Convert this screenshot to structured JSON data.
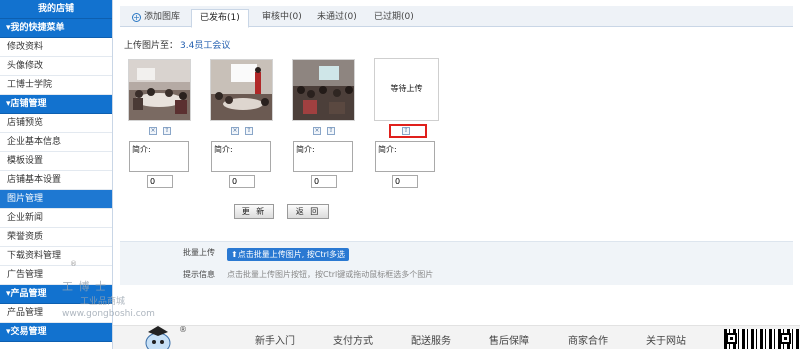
{
  "sidebar": {
    "store_header": "我的店铺",
    "quick_menu": {
      "title": "▾我的快捷菜单",
      "items": [
        "修改资料",
        "头像修改",
        "工博士学院"
      ]
    },
    "store_manage": {
      "title": "▾店铺管理",
      "items": [
        "店铺预览",
        "企业基本信息",
        "模板设置",
        "店铺基本设置",
        "图片管理",
        "企业新闻",
        "荣誉资质",
        "下载资料管理",
        "广告管理"
      ]
    },
    "product_manage": {
      "title": "▾产品管理",
      "items": [
        "产品管理"
      ]
    },
    "trade_manage": {
      "title": "▾交易管理"
    },
    "active_item": "图片管理"
  },
  "tabs": [
    {
      "label": "添加图库",
      "icon": "plus-icon"
    },
    {
      "label": "已发布(1)",
      "active": true
    },
    {
      "label": "审核中(0)"
    },
    {
      "label": "未通过(0)"
    },
    {
      "label": "已过期(0)"
    }
  ],
  "upload_to": {
    "label": "上传图片至：",
    "album": "3.4员工会议"
  },
  "photos": [
    {
      "memo_label": "简介:",
      "memo_value": "",
      "order": "0"
    },
    {
      "memo_label": "简介:",
      "memo_value": "",
      "order": "0"
    },
    {
      "memo_label": "简介:",
      "memo_value": "",
      "order": "0"
    },
    {
      "memo_label": "简介:",
      "memo_value": "",
      "order": "0",
      "pending_text": "等待上传"
    }
  ],
  "buttons": {
    "update": "更 新",
    "back": "返 回"
  },
  "batch": {
    "label": "批量上传",
    "button": "⬆点击批量上传图片, 按Ctrl多选",
    "tip_label": "提示信息",
    "tip_text": "点击批量上传图片按钮，按Ctrl键或拖动鼠标框选多个图片"
  },
  "footer": {
    "links": [
      "新手入门",
      "支付方式",
      "配送服务",
      "售后保障",
      "商家合作",
      "关于网站"
    ]
  },
  "watermark": {
    "brand": "工 博 士",
    "sub": "工业品商城",
    "url": "www.gongboshi.com",
    "reg": "®"
  },
  "colors": {
    "sidebar_header": "#1272cf",
    "active_item": "#1e78d2",
    "highlight_box": "#e0201c",
    "link": "#2460b0"
  }
}
